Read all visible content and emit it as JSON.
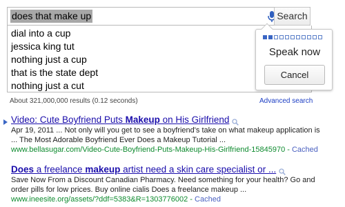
{
  "search": {
    "query": "does that make up",
    "button_label": "Search"
  },
  "suggestions": [
    "dial into a cup",
    "jessica king tut",
    "nothing just a cup",
    "that is the state dept",
    "nothing just a cut"
  ],
  "stats": {
    "text": "About 321,000,000 results (0.12 seconds)",
    "advanced_label": "Advanced search"
  },
  "voice": {
    "prompt": "Speak now",
    "cancel_label": "Cancel",
    "level_cells_total": 11,
    "level_cells_active": 2
  },
  "results": [
    {
      "title_parts": [
        "Video: Cute Boyfriend Puts ",
        "Makeup",
        " on His Girlfriend"
      ],
      "snippet_line1": "Apr 19, 2011 ... Not only will you get to see a boyfriend's take on what makeup application is",
      "snippet_line2": "... The Most Adorable Boyfriend Ever Does a Makeup Tutorial ...",
      "url": "www.bellasugar.com/Video-Cute-Boyfriend-Puts-Makeup-His-Girlfriend-15845970",
      "cached": "Cached"
    },
    {
      "title_parts": [
        "Does",
        " a freelance ",
        "makeup",
        " artist need a skin care specialist or ..."
      ],
      "snippet_line1": "Save Now From a Discount Canadian Pharmacy. Need something for your health? Go and",
      "snippet_line2": "order pills for low prices. Buy online cialis Does a freelance makeup ...",
      "url": "www.ineesite.org/assets/?ddf=5383&R=1303776002",
      "cached": "Cached"
    }
  ],
  "colors": {
    "link": "#1a0dab",
    "url": "#0d8a2e",
    "accent": "#3a66c4"
  }
}
